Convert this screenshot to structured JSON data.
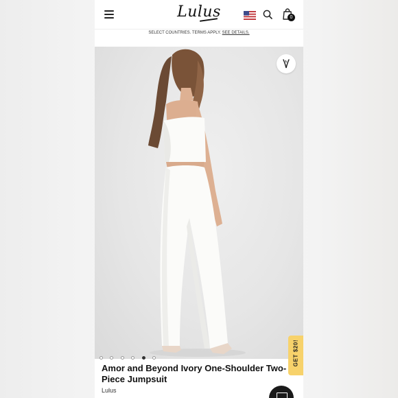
{
  "header": {
    "logo_text": "Lulus",
    "cart_count": "0",
    "icons": [
      "menu-icon",
      "us-flag-icon",
      "search-icon",
      "shopping-bag-icon"
    ]
  },
  "promo": {
    "text": "SELECT COUNTRIES. TERMS APPLY.",
    "link": "SEE DETAILS."
  },
  "gallery": {
    "total_images": 6,
    "active_index": 4
  },
  "coupon": {
    "label": "GET $20!"
  },
  "product": {
    "title": "Amor and Beyond Ivory One-Shoulder Two-Piece Jumpsuit",
    "brand": "Lulus"
  },
  "colors": {
    "accent_coupon": "#f7d26b",
    "dark": "#111111",
    "garment_ivory": "#fbfbf9"
  }
}
